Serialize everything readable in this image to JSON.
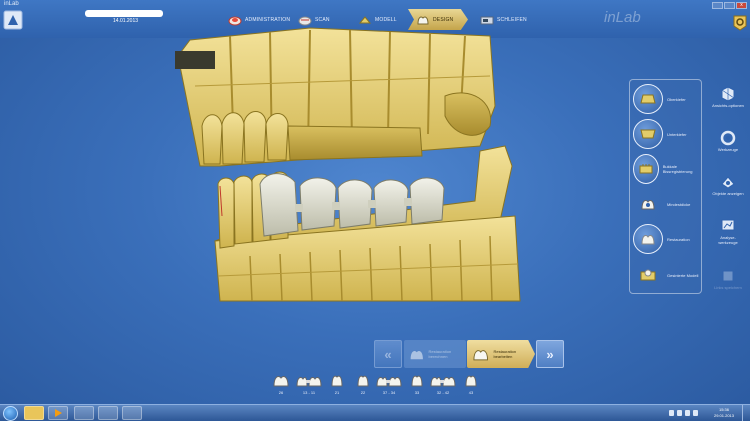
{
  "window": {
    "title": "inLab",
    "brand": "inLab",
    "close": "x"
  },
  "header": {
    "date": "14.01.2013",
    "phases": [
      {
        "label": "ADMINISTRATION",
        "icon": "administration-icon"
      },
      {
        "label": "SCAN",
        "icon": "scan-icon"
      },
      {
        "label": "MODELL",
        "icon": "model-icon"
      },
      {
        "label": "DESIGN",
        "icon": "design-icon",
        "active": true
      },
      {
        "label": "SCHLEIFEN",
        "icon": "grinding-icon"
      }
    ]
  },
  "view_panel": {
    "items": [
      {
        "label": "Oberkiefer",
        "icon": "upper-jaw-icon"
      },
      {
        "label": "Unterkiefer",
        "icon": "lower-jaw-icon"
      },
      {
        "label": "Bukkale Bissregistrierung",
        "icon": "buccal-bite-icon"
      },
      {
        "label": "Mindestdicke",
        "icon": "min-thickness-icon"
      },
      {
        "label": "Restauration",
        "icon": "restoration-icon"
      },
      {
        "label": "Gesinterte Modell",
        "icon": "sintered-model-icon"
      }
    ]
  },
  "right_toolbar": {
    "items": [
      {
        "label": "Ansichts-optionen",
        "icon": "view-options-icon"
      },
      {
        "label": "Werkzeuge",
        "icon": "tools-icon"
      },
      {
        "label": "Objekte anzeigen",
        "icon": "show-objects-icon"
      },
      {
        "label": "Analyse-werkzeuge",
        "icon": "analysis-tools-icon"
      },
      {
        "label": "Links speichern",
        "icon": "save-icon",
        "disabled": true
      }
    ]
  },
  "step_nav": {
    "previous": "Restauration berechnen",
    "current": "Restauration bearbeiten"
  },
  "teeth": [
    {
      "label": "26"
    },
    {
      "label": "13 - 11"
    },
    {
      "label": "21"
    },
    {
      "label": "22"
    },
    {
      "label": "37 - 34"
    },
    {
      "label": "33"
    },
    {
      "label": "32 - 42"
    },
    {
      "label": "43"
    }
  ],
  "taskbar": {
    "time": "15:36",
    "date": "29.01.2013"
  },
  "colors": {
    "model": "#e2cd6a",
    "restoration": "#d6d6c2",
    "background": "#3a6fba",
    "accent": "#d9bf6b"
  }
}
